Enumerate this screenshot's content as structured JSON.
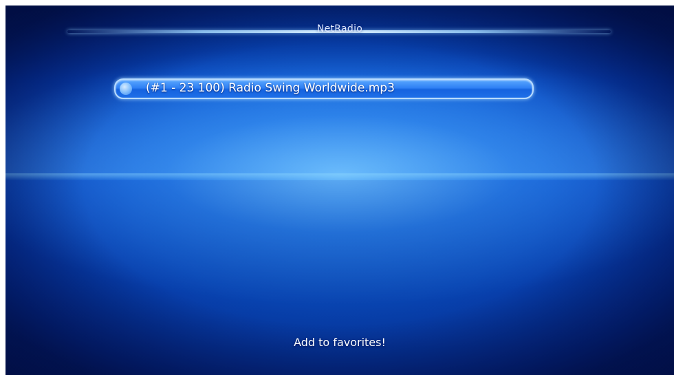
{
  "window": {
    "title": "NetRadio"
  },
  "list": {
    "items": [
      {
        "label": "(#1 - 23 100) Radio Swing Worldwide.mp3",
        "selected": true
      }
    ]
  },
  "footer": {
    "message": "Add to favorites!"
  },
  "colors": {
    "background": "#0b55cf",
    "highlight": "#2f80f4",
    "text": "#ffffff"
  }
}
